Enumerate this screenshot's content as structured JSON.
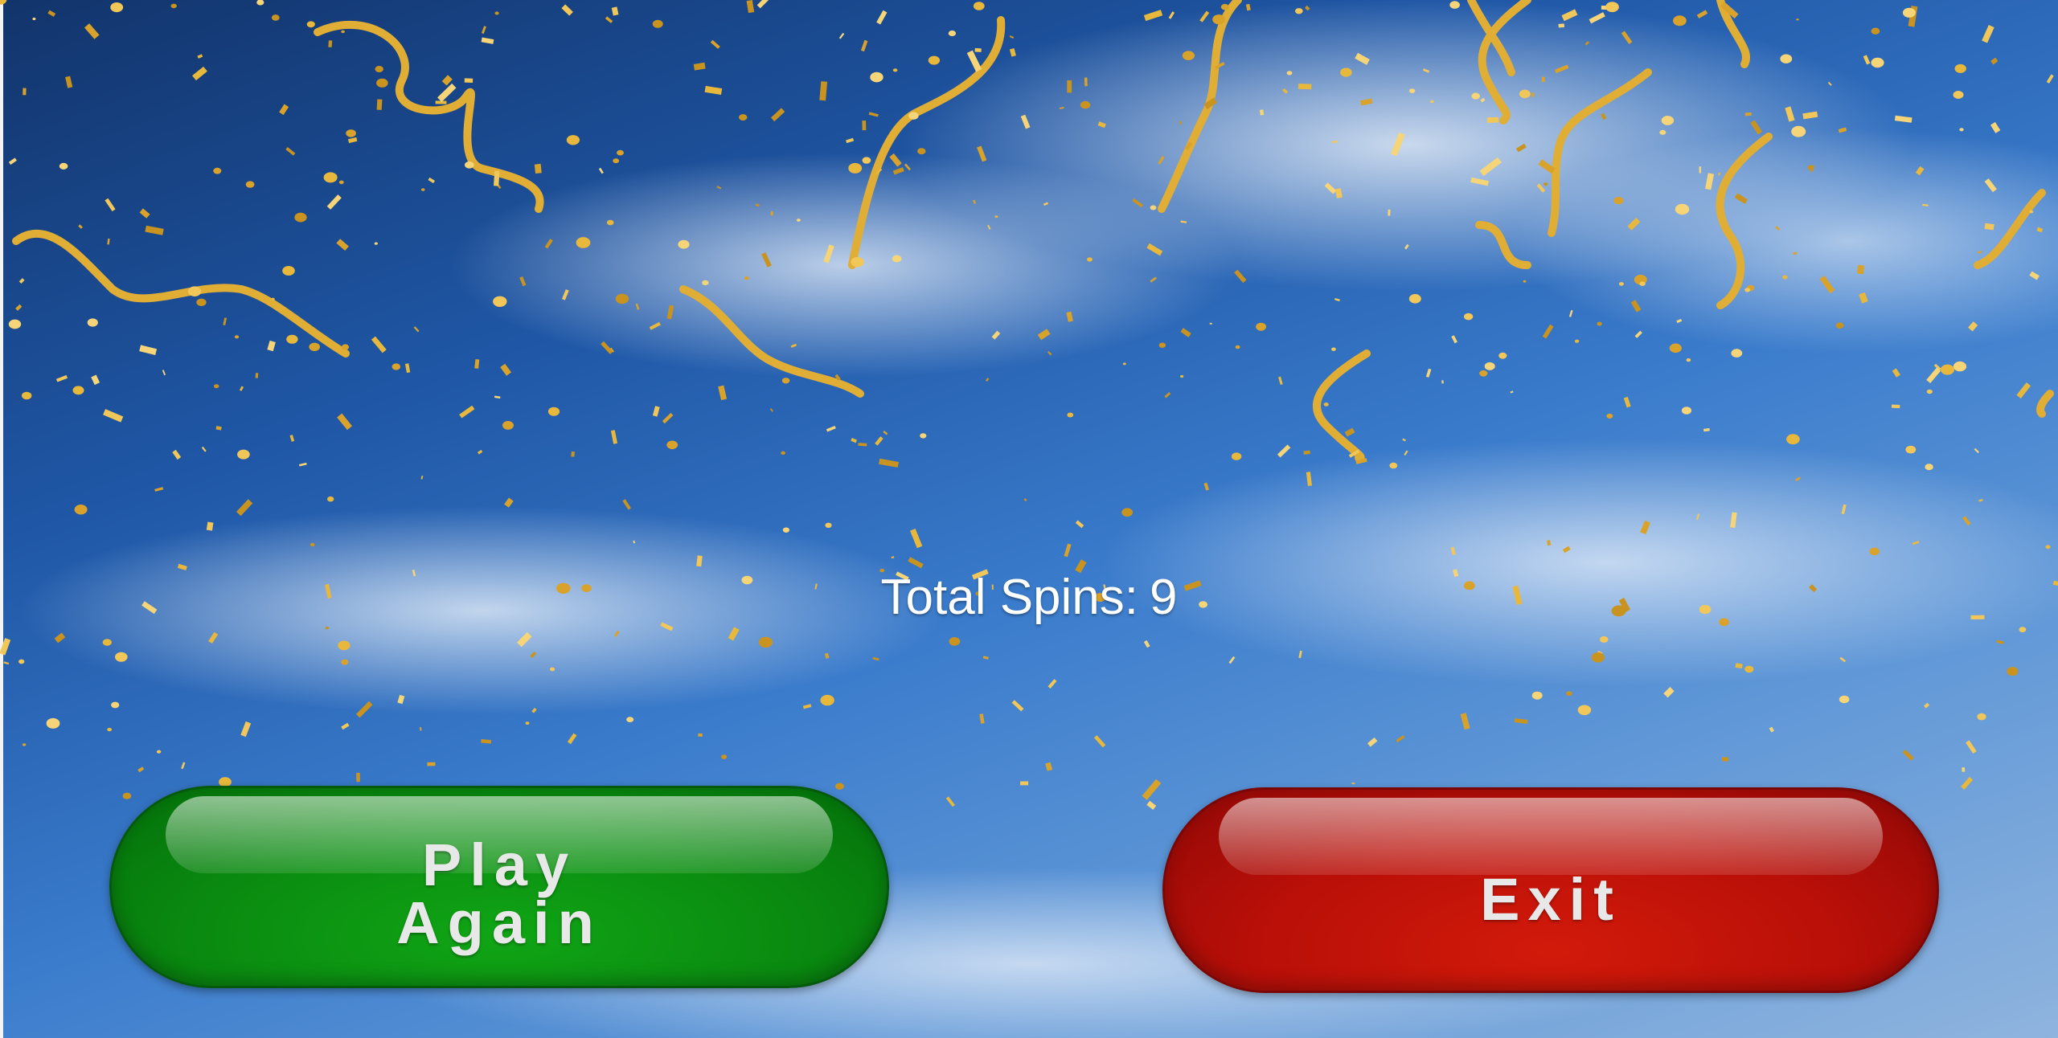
{
  "stats": {
    "total_spins_label": "Total Spins:",
    "total_spins_value": "9"
  },
  "buttons": {
    "play_again_label": "Play\nAgain",
    "exit_label": "Exit"
  },
  "colors": {
    "play_again": "#0a8a10",
    "exit": "#b80f08",
    "confetti": "#e7b83c",
    "sky_dark": "#12346b",
    "sky_light": "#8fb4de"
  }
}
